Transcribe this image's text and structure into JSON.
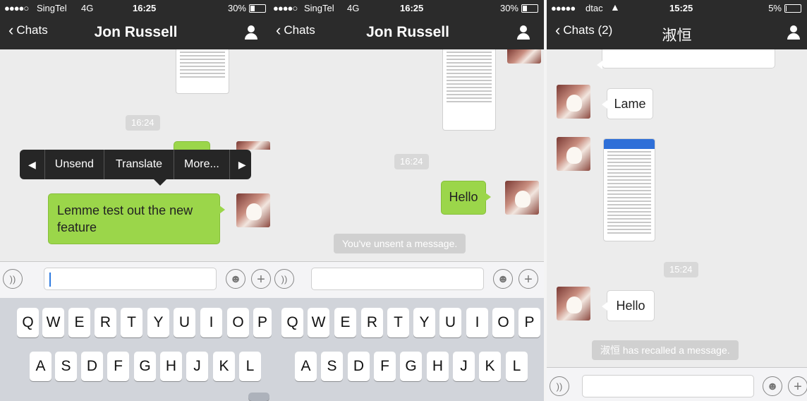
{
  "panels": [
    {
      "status": {
        "signal": "●●●●○",
        "carrier": "SingTel",
        "network": "4G",
        "time": "16:25",
        "battery": "30%"
      },
      "nav": {
        "back": "Chats",
        "title": "Jon Russell"
      },
      "timestamp": "16:24",
      "context_menu": {
        "items": [
          "Unsend",
          "Translate",
          "More..."
        ]
      },
      "outgoing": "Lemme test out the new feature"
    },
    {
      "status": {
        "signal": "●●●●○",
        "carrier": "SingTel",
        "network": "4G",
        "time": "16:25",
        "battery": "30%"
      },
      "nav": {
        "back": "Chats",
        "title": "Jon Russell"
      },
      "timestamp": "16:24",
      "outgoing": "Hello",
      "system": "You've unsent a message."
    },
    {
      "status": {
        "signal": "●●●●●",
        "carrier": "dtac",
        "network": "wifi",
        "time": "15:25",
        "battery": "5%"
      },
      "nav": {
        "back": "Chats (2)",
        "title": "淑恒"
      },
      "incoming1": "Lame",
      "timestamp": "15:24",
      "incoming2": "Hello",
      "system": "淑恒 has recalled a message."
    }
  ],
  "keyboard": {
    "row1": [
      "Q",
      "W",
      "E",
      "R",
      "T",
      "Y",
      "U",
      "I",
      "O",
      "P"
    ],
    "row2": [
      "A",
      "S",
      "D",
      "F",
      "G",
      "H",
      "J",
      "K",
      "L"
    ]
  },
  "icons": {
    "back": "chevron-left-icon",
    "contact": "person-icon",
    "voice": "voice-icon",
    "emoji": "emoji-icon",
    "plus": "plus-icon",
    "menu_left": "triangle-left-icon",
    "menu_right": "triangle-right-icon"
  },
  "colors": {
    "nav": "#2b2b2b",
    "outgoing_bubble": "#9bd64a",
    "chat_bg": "#ececec"
  }
}
